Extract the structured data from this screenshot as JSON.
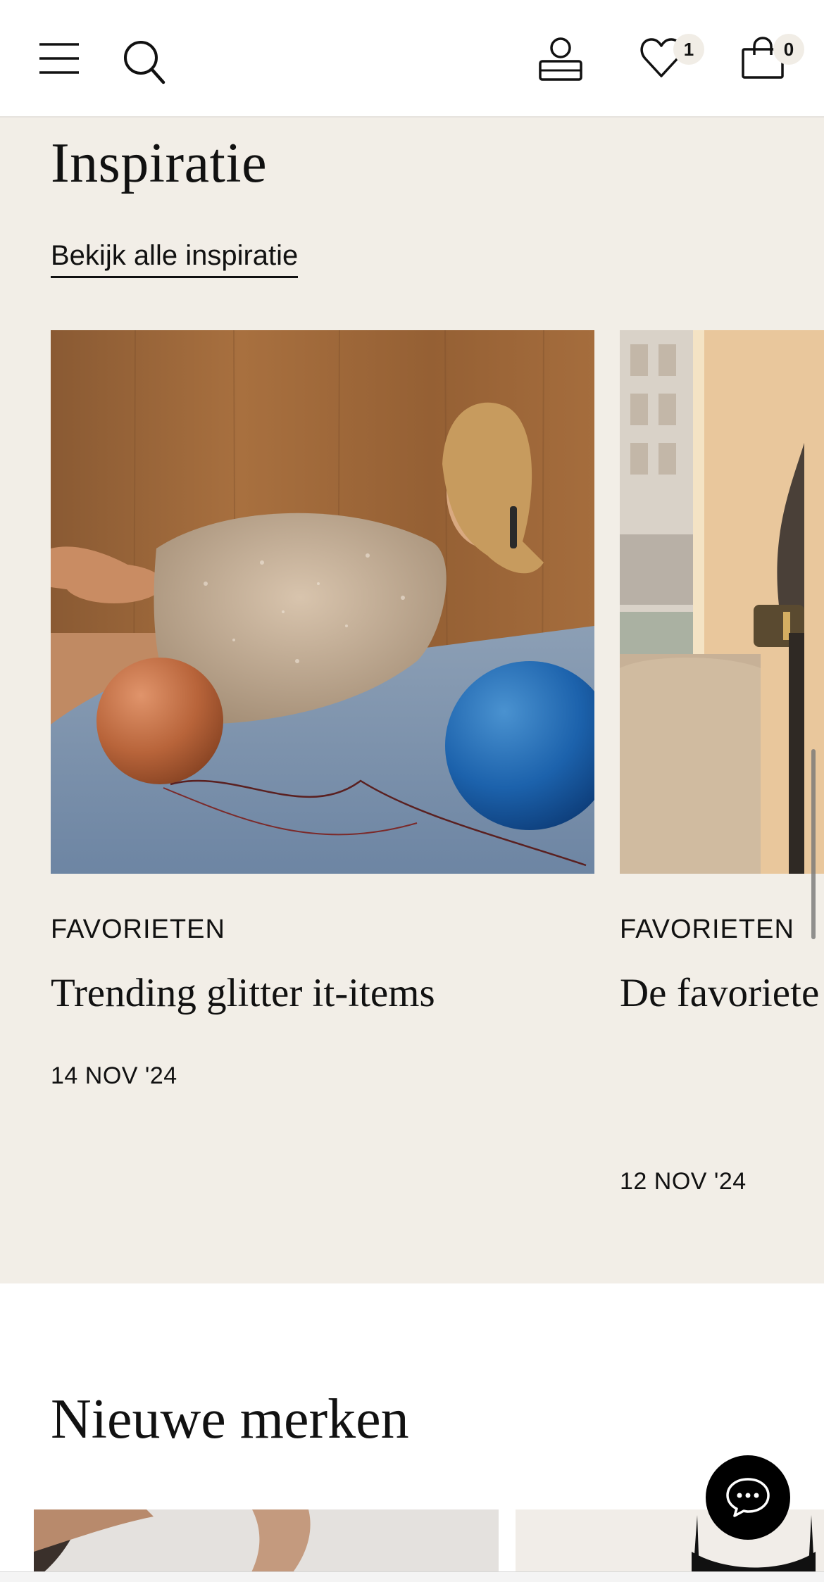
{
  "header": {
    "wishlist_count": "1",
    "cart_count": "0",
    "icons": [
      "menu-icon",
      "search-icon",
      "account-icon",
      "heart-icon",
      "bag-icon"
    ]
  },
  "inspiration": {
    "title": "Inspiratie",
    "view_all_label": "Bekijk alle inspiratie",
    "cards": [
      {
        "category": "FAVORIETEN",
        "title": "Trending glitter it-items",
        "date": "14 NOV '24"
      },
      {
        "category": "FAVORIETEN",
        "title": "De favoriete modejourna Broek",
        "date": "12 NOV '24"
      }
    ]
  },
  "brands": {
    "title": "Nieuwe merken"
  },
  "colors": {
    "header_bg": "#ffffff",
    "section_bg": "#f2eee7",
    "text": "#111111",
    "badge_bg": "#f1ede6",
    "chat_bg": "#000000"
  }
}
